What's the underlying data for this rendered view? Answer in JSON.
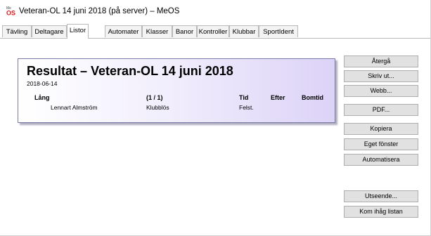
{
  "window": {
    "title": "Veteran-OL 14 juni 2018 (på server) – MeOS"
  },
  "tabs": [
    {
      "label": "Tävling"
    },
    {
      "label": "Deltagare"
    },
    {
      "label": "Listor"
    },
    {
      "label": "Automater"
    },
    {
      "label": "Klasser"
    },
    {
      "label": "Banor"
    },
    {
      "label": "Kontroller"
    },
    {
      "label": "Klubbar"
    },
    {
      "label": "SportIdent"
    }
  ],
  "active_tab": "Listor",
  "report": {
    "title": "Resultat – Veteran-OL 14 juni 2018",
    "date": "2018-06-14",
    "class_name": "Lång",
    "count": "(1 / 1)",
    "col_tid": "Tid",
    "col_efter": "Efter",
    "col_bomtid": "Bomtid",
    "rows": [
      {
        "name": "Lennart Almström",
        "club": "Klubblös",
        "time": "Felst."
      }
    ]
  },
  "buttons": {
    "back": "Återgå",
    "print": "Skriv ut...",
    "web": "Webb...",
    "pdf": "PDF...",
    "copy": "Kopiera",
    "own_window": "Eget fönster",
    "automate": "Automatisera",
    "appearance": "Utseende...",
    "remember": "Kom ihåg listan"
  }
}
